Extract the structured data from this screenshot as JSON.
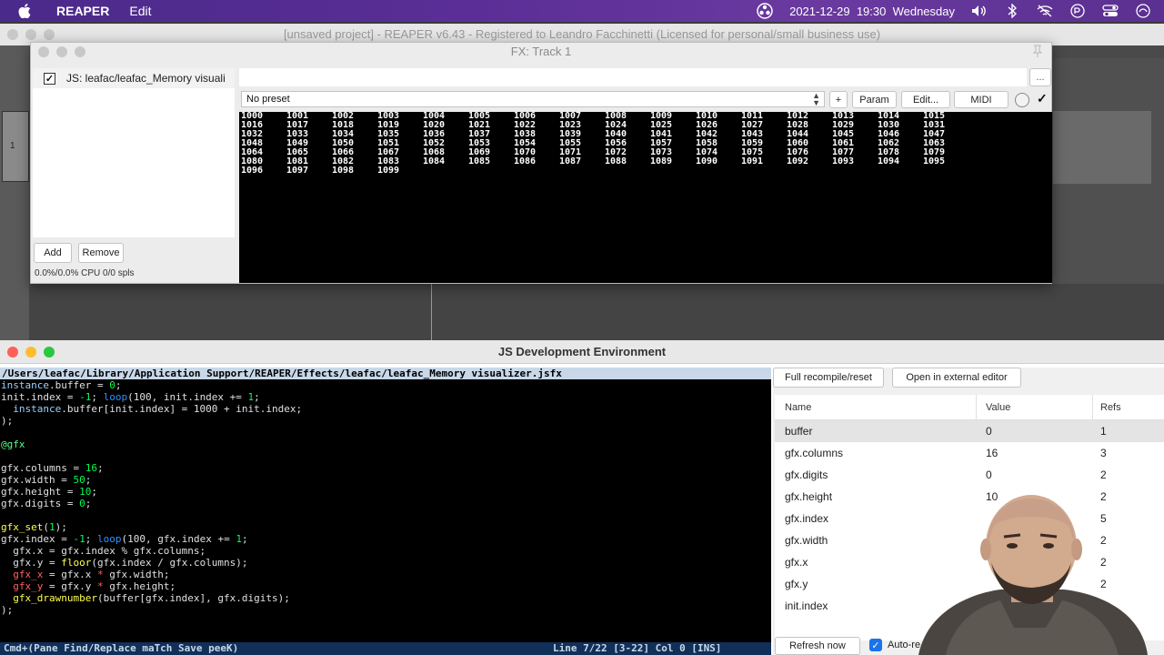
{
  "menubar": {
    "app_name": "REAPER",
    "menu_edit": "Edit",
    "datetime": "2021-12-29  19:30  Wednesday"
  },
  "reaper_window": {
    "title": "[unsaved project] - REAPER v6.43 - Registered to Leandro Facchinetti (Licensed for personal/small business use)",
    "track_number": "1"
  },
  "fx_window": {
    "title": "FX: Track 1",
    "plugin_name": "JS: leafac/leafac_Memory visuali",
    "add_label": "Add",
    "remove_label": "Remove",
    "cpu_label": "0.0%/0.0% CPU 0/0 spls",
    "more_label": "...",
    "preset": "No preset",
    "plus_label": "+",
    "param_label": "Param",
    "edit_label": "Edit...",
    "midi_label": "MIDI",
    "check_label": "✓",
    "gfx_numbers": [
      "1000",
      "1001",
      "1002",
      "1003",
      "1004",
      "1005",
      "1006",
      "1007",
      "1008",
      "1009",
      "1010",
      "1011",
      "1012",
      "1013",
      "1014",
      "1015",
      "1016",
      "1017",
      "1018",
      "1019",
      "1020",
      "1021",
      "1022",
      "1023",
      "1024",
      "1025",
      "1026",
      "1027",
      "1028",
      "1029",
      "1030",
      "1031",
      "1032",
      "1033",
      "1034",
      "1035",
      "1036",
      "1037",
      "1038",
      "1039",
      "1040",
      "1041",
      "1042",
      "1043",
      "1044",
      "1045",
      "1046",
      "1047",
      "1048",
      "1049",
      "1050",
      "1051",
      "1052",
      "1053",
      "1054",
      "1055",
      "1056",
      "1057",
      "1058",
      "1059",
      "1060",
      "1061",
      "1062",
      "1063",
      "1064",
      "1065",
      "1066",
      "1067",
      "1068",
      "1069",
      "1070",
      "1071",
      "1072",
      "1073",
      "1074",
      "1075",
      "1076",
      "1077",
      "1078",
      "1079",
      "1080",
      "1081",
      "1082",
      "1083",
      "1084",
      "1085",
      "1086",
      "1087",
      "1088",
      "1089",
      "1090",
      "1091",
      "1092",
      "1093",
      "1094",
      "1095",
      "1096",
      "1097",
      "1098",
      "1099"
    ],
    "gfx_columns": 16
  },
  "jsdev": {
    "title": "JS Development Environment",
    "file_path": "/Users/leafac/Library/Application Support/REAPER/Effects/leafac/leafac_Memory visualizer.jsfx",
    "code_lines": [
      [
        [
          "var",
          "instance"
        ],
        [
          "def",
          ".buffer = "
        ],
        [
          "num",
          "0"
        ],
        [
          "def",
          ";"
        ]
      ],
      [
        [
          "def",
          "init.index = "
        ],
        [
          "num",
          "-1"
        ],
        [
          "def",
          "; "
        ],
        [
          "kw",
          "loop"
        ],
        [
          "def",
          "(100, init.index += "
        ],
        [
          "num",
          "1"
        ],
        [
          "def",
          ";"
        ]
      ],
      [
        [
          "def",
          "  "
        ],
        [
          "var",
          "instance"
        ],
        [
          "def",
          ".buffer[init.index] = 1000 + init.index;"
        ]
      ],
      [
        [
          "def",
          ");"
        ]
      ],
      [],
      [
        [
          "sec",
          "@gfx"
        ]
      ],
      [],
      [
        [
          "def",
          "gfx.columns = "
        ],
        [
          "num",
          "16"
        ],
        [
          "def",
          ";"
        ]
      ],
      [
        [
          "def",
          "gfx.width = "
        ],
        [
          "num",
          "50"
        ],
        [
          "def",
          ";"
        ]
      ],
      [
        [
          "def",
          "gfx.height = "
        ],
        [
          "num",
          "10"
        ],
        [
          "def",
          ";"
        ]
      ],
      [
        [
          "def",
          "gfx.digits = "
        ],
        [
          "num",
          "0"
        ],
        [
          "def",
          ";"
        ]
      ],
      [],
      [
        [
          "fn",
          "gfx_set"
        ],
        [
          "def",
          "("
        ],
        [
          "num",
          "1"
        ],
        [
          "def",
          ");"
        ]
      ],
      [
        [
          "def",
          "gfx.index = "
        ],
        [
          "num",
          "-1"
        ],
        [
          "def",
          "; "
        ],
        [
          "kw",
          "loop"
        ],
        [
          "def",
          "(100, gfx.index += "
        ],
        [
          "num",
          "1"
        ],
        [
          "def",
          ";"
        ]
      ],
      [
        [
          "def",
          "  gfx.x = gfx.index % gfx.columns;"
        ]
      ],
      [
        [
          "def",
          "  gfx.y = "
        ],
        [
          "fn",
          "floor"
        ],
        [
          "def",
          "(gfx.index / gfx.columns);"
        ]
      ],
      [
        [
          "red",
          "  gfx_x"
        ],
        [
          "def",
          " = gfx.x "
        ],
        [
          "red",
          "*"
        ],
        [
          "def",
          " gfx.width;"
        ]
      ],
      [
        [
          "red",
          "  gfx_y"
        ],
        [
          "def",
          " = gfx.y "
        ],
        [
          "red",
          "*"
        ],
        [
          "def",
          " gfx.height;"
        ]
      ],
      [
        [
          "def",
          "  "
        ],
        [
          "fn",
          "gfx_drawnumber"
        ],
        [
          "def",
          "(buffer[gfx.index], gfx.digits);"
        ]
      ],
      [
        [
          "def",
          ");"
        ]
      ]
    ],
    "status_left": "Cmd+(Pane Find/Replace maTch Save peeK)",
    "status_right": "Line 7/22 [3-22] Col 0 [INS]",
    "recompile_label": "Full recompile/reset",
    "external_label": "Open in external editor",
    "table_headers": {
      "name": "Name",
      "value": "Value",
      "refs": "Refs"
    },
    "variables": [
      {
        "name": "buffer",
        "value": "0",
        "refs": "1"
      },
      {
        "name": "gfx.columns",
        "value": "16",
        "refs": "3"
      },
      {
        "name": "gfx.digits",
        "value": "0",
        "refs": "2"
      },
      {
        "name": "gfx.height",
        "value": "10",
        "refs": "2"
      },
      {
        "name": "gfx.index",
        "value": "",
        "refs": "5"
      },
      {
        "name": "gfx.width",
        "value": "",
        "refs": "2"
      },
      {
        "name": "gfx.x",
        "value": "",
        "refs": "2"
      },
      {
        "name": "gfx.y",
        "value": "",
        "refs": "2"
      },
      {
        "name": "init.index",
        "value": "",
        "refs": "4"
      }
    ],
    "refresh_label": "Refresh now",
    "autorefresh_label": "Auto-re"
  },
  "colors": {
    "accent": "#1a73e8",
    "status_bar": "#10305a",
    "menubar": "#5a2e96"
  },
  "icons": [
    "apple-icon",
    "obs-icon",
    "volume-icon",
    "bluetooth-icon",
    "wifi-icon",
    "control-center-icon",
    "siri-icon",
    "checkmark-icon",
    "pin-icon"
  ]
}
